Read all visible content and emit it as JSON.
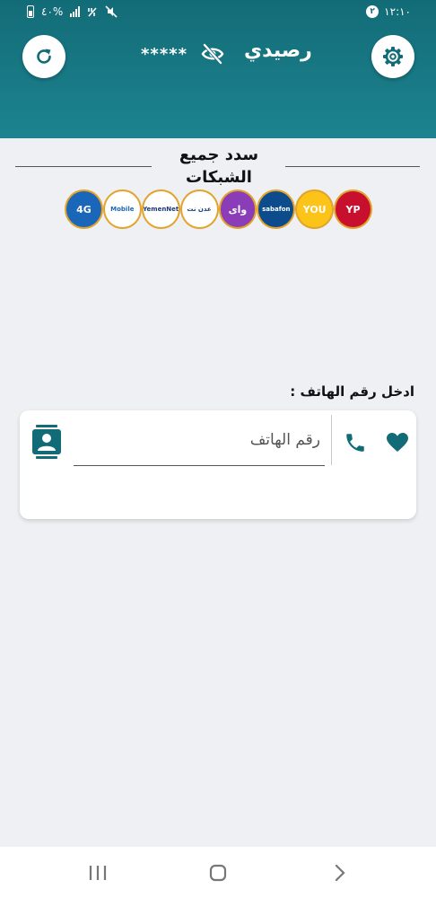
{
  "status_bar": {
    "time": "١٢:١٠",
    "notification_count": "٢",
    "battery_text": "٤٠%"
  },
  "header": {
    "title": "رصيدي",
    "balance_mask": "*****",
    "color_primary": "#126c77",
    "icons": {
      "refresh": "refresh-icon",
      "settings": "gear-icon",
      "visibility": "eye-off-icon"
    }
  },
  "networks": {
    "title": "سدد جميع الشبكات",
    "logos": [
      {
        "name": "Yemen Post",
        "text": "YP",
        "bg": "#c8102e",
        "fg": "#ffffff"
      },
      {
        "name": "YOU",
        "text": "YOU",
        "bg": "#fcc419",
        "fg": "#ffffff"
      },
      {
        "name": "Sabafon",
        "text": "sabafon",
        "bg": "#0d4c8c",
        "fg": "#ffffff"
      },
      {
        "name": "Y",
        "text": "وای",
        "bg": "#8a3db6",
        "fg": "#ffffff"
      },
      {
        "name": "Aden Net",
        "text": "عدن نت",
        "bg": "#ffffff",
        "fg": "#1a3b7a"
      },
      {
        "name": "YemenNet",
        "text": "YemenNet",
        "bg": "#ffffff",
        "fg": "#1a3b7a"
      },
      {
        "name": "Yemen Mobile",
        "text": "Mobile",
        "bg": "#ffffff",
        "fg": "#1a66b8"
      },
      {
        "name": "4G Yemen",
        "text": "4G",
        "bg": "#1a66b8",
        "fg": "#ffffff"
      }
    ]
  },
  "phone_form": {
    "label": "ادخل رقم الهاتف :",
    "placeholder": "رقم الهاتف",
    "value": "",
    "icons": {
      "favorite": "heart-icon",
      "phone": "phone-icon",
      "contacts": "contacts-icon"
    }
  },
  "nav_bar": {
    "icons": {
      "recents": "recents-icon",
      "home": "home-icon",
      "back": "back-icon"
    }
  }
}
